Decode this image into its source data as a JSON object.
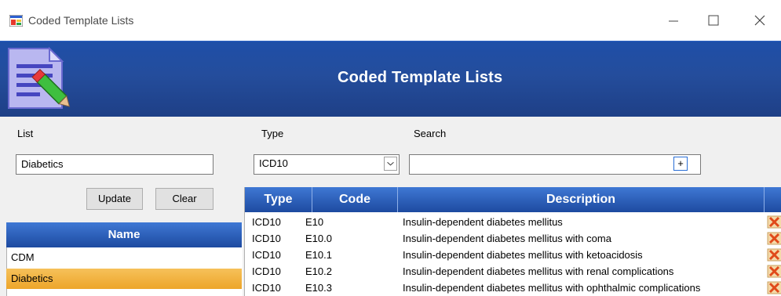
{
  "window": {
    "title": "Coded Template Lists",
    "icons": {
      "app": "app-window-icon",
      "minimize": "minimize-icon",
      "maximize": "maximize-icon",
      "close": "close-icon"
    }
  },
  "header": {
    "title": "Coded Template Lists",
    "icon": "document-edit-icon",
    "color": "#1f4fa8"
  },
  "form": {
    "list_label": "List",
    "list_value": "Diabetics",
    "type_label": "Type",
    "type_value": "ICD10",
    "search_label": "Search",
    "search_value": "",
    "plus_label": "+",
    "update_label": "Update",
    "clear_label": "Clear"
  },
  "names": {
    "header": "Name",
    "items": [
      "CDM",
      "Diabetics"
    ],
    "selected": "Diabetics",
    "selected_color": "#f0b040"
  },
  "grid": {
    "columns": [
      "Type",
      "Code",
      "Description"
    ],
    "rows": [
      {
        "type": "ICD10",
        "code": "E10",
        "description": "Insulin-dependent diabetes mellitus"
      },
      {
        "type": "ICD10",
        "code": "E10.0",
        "description": "Insulin-dependent diabetes mellitus with coma"
      },
      {
        "type": "ICD10",
        "code": "E10.1",
        "description": "Insulin-dependent diabetes mellitus with ketoacidosis"
      },
      {
        "type": "ICD10",
        "code": "E10.2",
        "description": "Insulin-dependent diabetes mellitus with renal complications"
      },
      {
        "type": "ICD10",
        "code": "E10.3",
        "description": "Insulin-dependent diabetes mellitus with ophthalmic complications"
      }
    ],
    "row_icon": "delete-row-icon"
  }
}
